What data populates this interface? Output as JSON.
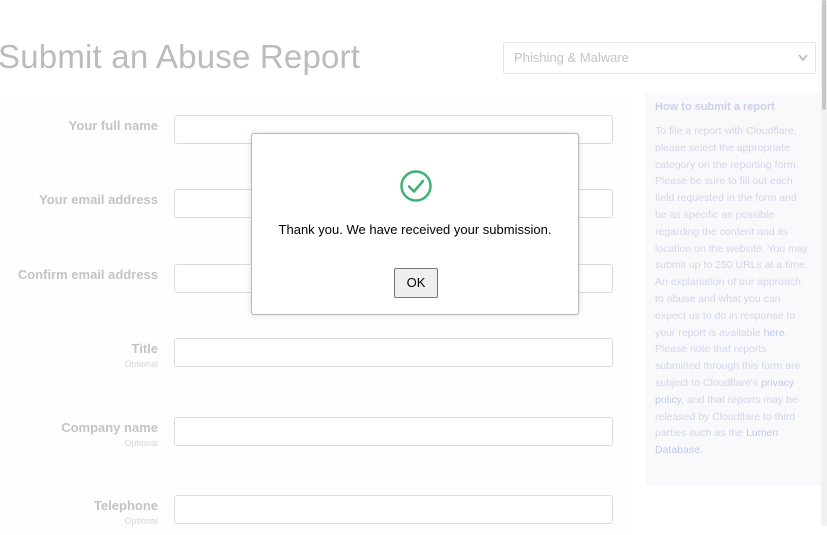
{
  "page": {
    "title": "Submit an Abuse Report",
    "category": {
      "selected": "Phishing & Malware",
      "chevron_icon": "chevron-down-icon"
    }
  },
  "form": {
    "fields": [
      {
        "label": "Your full name",
        "sub": ""
      },
      {
        "label": "Your email address",
        "sub": ""
      },
      {
        "label": "Confirm email address",
        "sub": ""
      },
      {
        "label": "Title",
        "sub": "Optional"
      },
      {
        "label": "Company name",
        "sub": "Optional"
      },
      {
        "label": "Telephone",
        "sub": "Optional"
      }
    ]
  },
  "help": {
    "title": "How to submit a report",
    "body_1": "To file a report with Cloudflare, please select the appropriate category on the reporting form. Please be sure to fill out each field requested in the form and be as specific as possible regarding the content and its location on the website. You may submit up to 250 URLs at a time. An explanation of our approach to abuse and what you can expect us to do in response to your report is available",
    "link_here": "here",
    "body_2": ". Please note that reports submitted through this form are subject to Cloudflare's",
    "link_privacy": "privacy policy",
    "body_3": ", and that reports may be released by Cloudflare to third parties such as the",
    "link_lumen": "Lumen Database",
    "body_4": "."
  },
  "modal": {
    "icon": "check-circle-icon",
    "message": "Thank you. We have received your submission.",
    "ok_label": "OK",
    "accent_color": "#3cb371"
  }
}
